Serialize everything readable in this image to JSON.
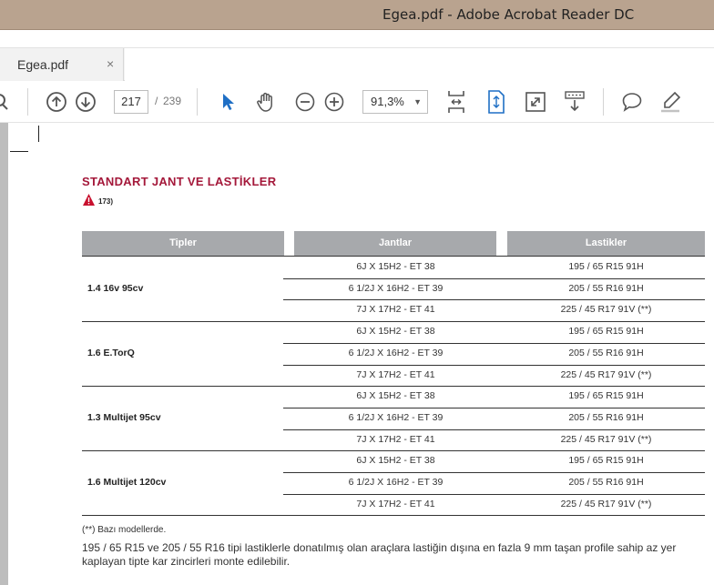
{
  "window": {
    "title": "Egea.pdf - Adobe Acrobat Reader DC"
  },
  "tab": {
    "label": "Egea.pdf",
    "close": "×"
  },
  "toolbar": {
    "page_current": "217",
    "page_separator": "/",
    "page_total": "239",
    "zoom": "91,3%"
  },
  "document": {
    "heading": "STANDART JANT VE LASTİKLER",
    "warning_ref": "173)",
    "table": {
      "headers": [
        "Tipler",
        "Jantlar",
        "Lastikler"
      ],
      "groups": [
        {
          "tip": "1.4 16v 95cv",
          "rows": [
            {
              "jant": "6J X 15H2 - ET 38",
              "lastik": "195 / 65 R15 91H"
            },
            {
              "jant": "6 1/2J X 16H2 - ET 39",
              "lastik": "205 / 55 R16 91H"
            },
            {
              "jant": "7J X 17H2 - ET 41",
              "lastik": "225 / 45 R17 91V (**)"
            }
          ]
        },
        {
          "tip": "1.6 E.TorQ",
          "rows": [
            {
              "jant": "6J X 15H2 - ET 38",
              "lastik": "195 / 65 R15 91H"
            },
            {
              "jant": "6 1/2J X 16H2 - ET 39",
              "lastik": "205 / 55 R16 91H"
            },
            {
              "jant": "7J X 17H2 - ET 41",
              "lastik": "225 / 45 R17 91V (**)"
            }
          ]
        },
        {
          "tip": "1.3 Multijet 95cv",
          "rows": [
            {
              "jant": "6J X 15H2 - ET 38",
              "lastik": "195 / 65 R15 91H"
            },
            {
              "jant": "6 1/2J X 16H2 - ET 39",
              "lastik": "205 / 55 R16 91H"
            },
            {
              "jant": "7J X 17H2 - ET 41",
              "lastik": "225 / 45 R17 91V (**)"
            }
          ]
        },
        {
          "tip": "1.6 Multijet 120cv",
          "rows": [
            {
              "jant": "6J X 15H2 - ET 38",
              "lastik": "195 / 65 R15 91H"
            },
            {
              "jant": "6 1/2J X 16H2 - ET 39",
              "lastik": "205 / 55 R16 91H"
            },
            {
              "jant": "7J X 17H2 - ET 41",
              "lastik": "225 / 45 R17 91V (**)"
            }
          ]
        }
      ]
    },
    "footnote": "(**) Bazı modellerde.",
    "paragraph": "195 / 65 R15 ve 205 / 55 R16 tipi lastiklerle donatılmış olan araçlara lastiğin dışına en fazla 9 mm taşan profile sahip az yer kaplayan tipte kar zincirleri monte edilebilir."
  },
  "colors": {
    "heading": "#a4183a",
    "header_bg": "#a7a9ac",
    "titlebar": "#b9a38f",
    "accent": "#1f6fc5"
  },
  "icons": [
    "search-icon",
    "page-up-icon",
    "page-down-icon",
    "select-arrow-icon",
    "hand-icon",
    "zoom-out-icon",
    "zoom-in-icon",
    "fit-page-icon",
    "scroll-mode-icon",
    "fullscreen-icon",
    "read-mode-icon",
    "comment-icon",
    "pen-icon",
    "warning-icon"
  ]
}
